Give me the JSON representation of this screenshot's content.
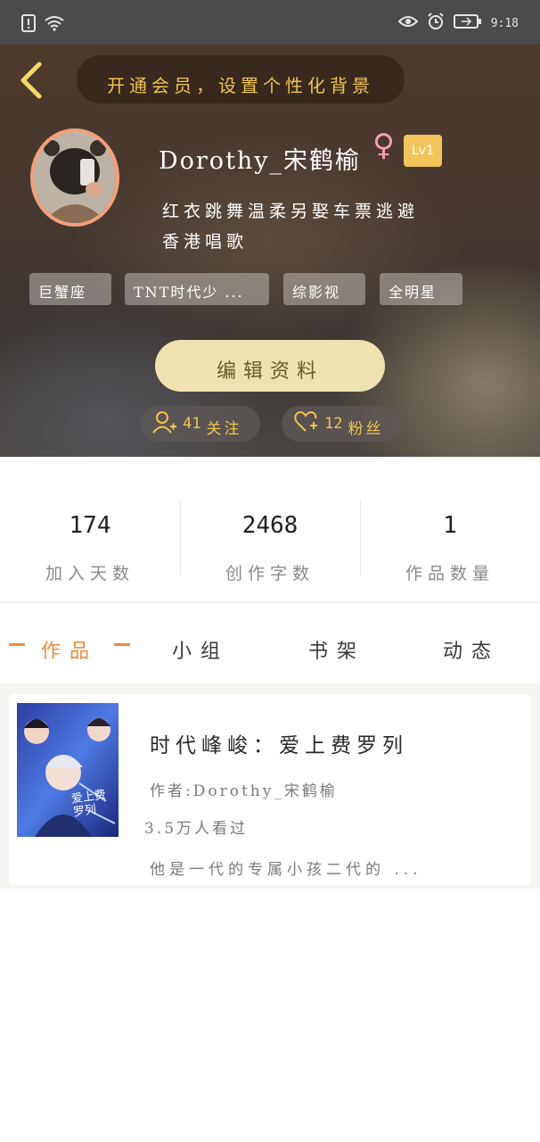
{
  "status_bar": {
    "time": "9:18",
    "icons": [
      "sim-alert-icon",
      "wifi-icon",
      "eye-icon",
      "alarm-icon",
      "battery-icon"
    ]
  },
  "header": {
    "back_icon": "chevron-left-icon",
    "vip_banner": "开通会员，设置个性化背景"
  },
  "profile": {
    "username": "Dorothy_宋鹤榆",
    "gender_icon": "female-icon",
    "gender_symbol": "♀",
    "level": "Lv1",
    "bio_line1": "红衣跳舞温柔另娶车票逃避",
    "bio_line2": "香港唱歌",
    "tags": [
      "巨蟹座",
      "TNT时代少 ...",
      "综影视",
      "全明星"
    ],
    "edit_button": "编辑资料",
    "following_count": "41",
    "following_label": "关注",
    "followers_count": "12",
    "followers_label": "粉丝"
  },
  "stats": [
    {
      "value": "174",
      "label": "加入天数"
    },
    {
      "value": "2468",
      "label": "创作字数"
    },
    {
      "value": "1",
      "label": "作品数量"
    }
  ],
  "tabs": [
    {
      "label": "作品",
      "active": true
    },
    {
      "label": "小组",
      "active": false
    },
    {
      "label": "书架",
      "active": false
    },
    {
      "label": "动态",
      "active": false
    }
  ],
  "works": [
    {
      "cover_text": "爱上费罗列",
      "title": "时代峰峻：爱上费罗列",
      "author": "作者:Dorothy_宋鹤榆",
      "views": "3.5万人看过",
      "description": "他是一代的专属小孩二代的 ..."
    }
  ],
  "colors": {
    "accent": "#f08a3c",
    "vip_gold": "#f0c44e",
    "level_badge": "#f1c55c",
    "edit_button_bg": "#efe1b0",
    "avatar_ring": "#f3a07a",
    "gender_pink": "#ff9bb8"
  }
}
